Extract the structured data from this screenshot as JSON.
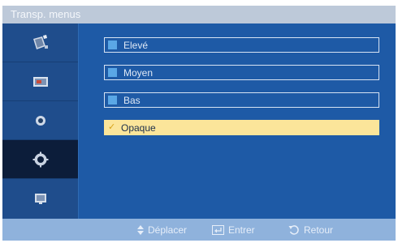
{
  "window": {
    "title": "Transp. menus"
  },
  "sidebar": {
    "items": [
      {
        "icon": "picture-icon",
        "active": false
      },
      {
        "icon": "input-source-icon",
        "active": false
      },
      {
        "icon": "sound-icon",
        "active": false
      },
      {
        "icon": "setup-gear-icon",
        "active": true
      },
      {
        "icon": "multi-display-icon",
        "active": false
      }
    ]
  },
  "menu": {
    "options": [
      {
        "label": "Elevé",
        "selected": false
      },
      {
        "label": "Moyen",
        "selected": false
      },
      {
        "label": "Bas",
        "selected": false
      },
      {
        "label": "Opaque",
        "selected": true
      }
    ],
    "check_glyph": "✓"
  },
  "footer": {
    "move_label": "Déplacer",
    "enter_label": "Entrer",
    "return_label": "Retour"
  },
  "colors": {
    "panel": "#1e5aa6",
    "selected_bg": "#fbe59a",
    "marker": "#5aa7e6"
  }
}
